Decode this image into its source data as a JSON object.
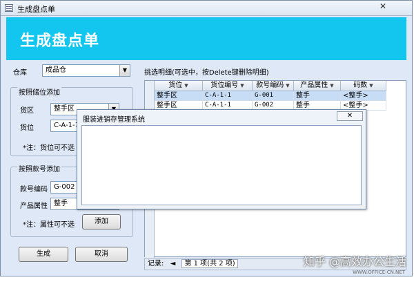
{
  "window": {
    "title": "生成盘点单",
    "close_glyph": "✕"
  },
  "banner": {
    "title": "生成盘点单"
  },
  "form": {
    "warehouse_label": "仓库",
    "warehouse_value": "成品仓",
    "location_section": "按照储位添加",
    "area_label": "货区",
    "area_value": "整手区",
    "location_label": "货位",
    "location_value": "C-A-1-1",
    "location_note": "*注：货位可不选",
    "style_section": "按照款号添加",
    "style_code_label": "款号编码",
    "style_code_value": "G-002",
    "attr_label": "产品属性",
    "attr_value": "整手",
    "attr_note": "*注：属性可不选",
    "add_button": "添加",
    "generate_button": "生成",
    "cancel_button": "取消"
  },
  "detail": {
    "title": "挑选明细(可选中，按Delete键删除明细)",
    "columns": [
      "货位",
      "货位编号",
      "款号编码",
      "产品属性",
      "码数"
    ],
    "rows": [
      [
        "整手区",
        "C-A-1-1",
        "G-001",
        "整手",
        "<整手>"
      ],
      [
        "整手区",
        "C-A-1-1",
        "G-002",
        "整手",
        "<整手>"
      ]
    ],
    "nav_label": "记录:",
    "nav_first": "◄",
    "nav_status": "第 1 项(共 2 项)"
  },
  "dialog": {
    "title": "服装进销存管理系统",
    "close_glyph": "✕"
  },
  "watermark": {
    "main": "知乎 @高效办公生活",
    "sub": "WWW.OFFICE-CN.NET"
  }
}
